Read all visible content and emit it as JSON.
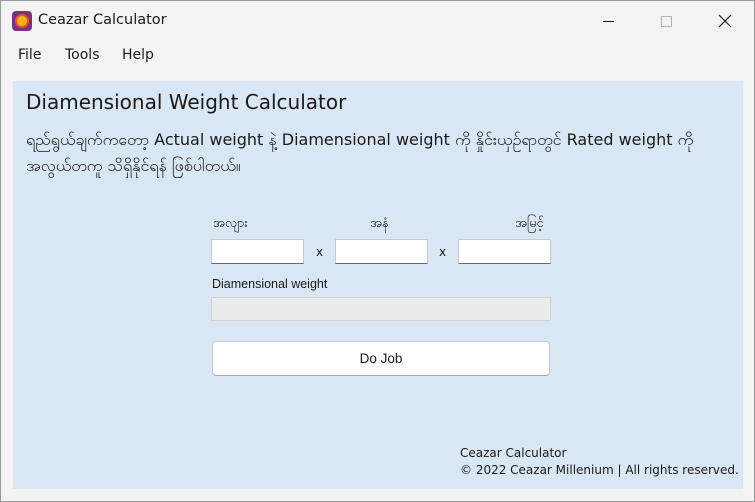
{
  "window": {
    "title": "Ceazar Calculator",
    "min_icon": "minimize-icon",
    "max_icon": "maximize-icon",
    "close_icon": "close-icon",
    "close_glyph": "✕"
  },
  "menu": {
    "file": "File",
    "tools": "Tools",
    "help": "Help"
  },
  "panel": {
    "title": "Diamensional Weight Calculator",
    "description": "ရည်ရွယ်ချက်ကတော့ Actual weight နဲ့ Diamensional weight ကို နှိုင်းယှဉ်ရာတွင် Rated weight ကို အလွယ်တကူ သိရှိနိုင်ရန် ဖြစ်ပါတယ်။",
    "length_label": "အလျား",
    "width_label": "အနံ",
    "height_label": "အမြင့်",
    "length_value": "",
    "width_value": "",
    "height_value": "",
    "times_symbol": "x",
    "result_label": "Diamensional weight",
    "result_value": "",
    "button_label": "Do Job",
    "footer_name": "Ceazar Calculator",
    "footer_copyright": "© 2022 Ceazar Millenium | All rights reserved."
  },
  "colors": {
    "panel_background": "#d9e6f3",
    "window_background": "#f3f3f3",
    "app_icon": "#7a2e8e"
  }
}
